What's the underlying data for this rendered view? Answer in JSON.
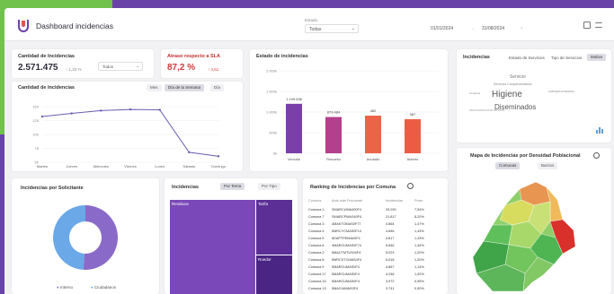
{
  "header": {
    "title": "Dashboard incidencias",
    "filter_label": "Estado",
    "filter_value": "Todas",
    "date_from": "01/01/2024",
    "date_to": "31/08/2024"
  },
  "kpi_incidencias": {
    "title": "Cantidad de Incidencias",
    "value": "2.571.475",
    "delta": "↑ 1,33 %",
    "select": "Todos"
  },
  "kpi_sla": {
    "title": "Atraso respecto a SLA",
    "value": "87,2 %",
    "delta": "↑ 4,61"
  },
  "line_card": {
    "title": "Cantidad de Incidencias",
    "tabs": [
      "Mes",
      "Día de la Semana",
      "Día"
    ],
    "chart_data": {
      "type": "line",
      "categories": [
        "Martes",
        "Jueves",
        "Miércoles",
        "Viernes",
        "Lunes",
        "Sábado",
        "Domingo"
      ],
      "values": [
        126,
        134,
        141,
        144,
        143,
        36,
        26
      ],
      "yticks": [
        "150",
        "125",
        "100",
        "75",
        "50"
      ],
      "ylim": [
        20,
        160
      ]
    }
  },
  "bar_card": {
    "title": "Estado de incidencias",
    "chart_data": {
      "type": "bar",
      "categories": [
        "Vencido",
        "Resuelto",
        "Anulado",
        "Abierto"
      ],
      "values": [
        1199536,
        879484,
        482,
        387
      ],
      "labels": [
        "1.199.536",
        "879.484",
        "482",
        "387"
      ],
      "colors": [
        "#7b3fa8",
        "#b43f8c",
        "#ec6448",
        "#ee5b45"
      ],
      "yticks": [
        "2.000k",
        "1.500k",
        "1.000k",
        "500k",
        "0k"
      ]
    }
  },
  "words_card": {
    "title": "Incidencias",
    "tabs": [
      "Estado de Servicios",
      "Tipo de Servicios",
      "Motivo"
    ],
    "words": [
      {
        "text": "Higiene",
        "size": 10
      },
      {
        "text": "Diseminados",
        "size": 8
      },
      {
        "text": "Servicio",
        "size": 5
      },
      {
        "text": "Servicios Complementarios",
        "size": 3.5
      },
      {
        "text": "LIMPIEZA INTEGRAL",
        "size": 3
      },
      {
        "text": "Limpieza",
        "size": 3
      },
      {
        "text": "PROPUESTAS POR VECINOS",
        "size": 2.8
      }
    ]
  },
  "donut_card": {
    "title": "Incidencias por Solicitante",
    "chart_data": {
      "type": "pie",
      "categories": [
        "Interno",
        "Ciudadanos"
      ],
      "values": [
        51,
        49
      ],
      "colors": [
        "#8a6ac8",
        "#6aa8e8"
      ]
    },
    "legend": [
      "Interno",
      "Ciudadanos"
    ]
  },
  "tree_card": {
    "title": "Incidencias",
    "tabs": [
      "Por Tema",
      "Por Tipo"
    ],
    "cells": [
      "Residuos",
      "Tarifa",
      "Roedor"
    ]
  },
  "ranking_card": {
    "title": "Ranking de Incidencias por Comuna",
    "headers": [
      "Comuna",
      "Auto más Frecuente",
      "Incidencias",
      "Prom"
    ],
    "rows": [
      [
        "Comuna 1",
        "SMARCUMA400F4",
        "33.290",
        "7,54%"
      ],
      [
        "Comuna 7",
        "SMARCPMAS40F4",
        "21.817",
        "5,20%"
      ],
      [
        "Comuna 3",
        "4MAKTOMAS0F77",
        "4.864",
        "1,47%"
      ],
      [
        "Comuna 4",
        "5MRCYCMAS0F14",
        "4.846",
        "1,43%"
      ],
      [
        "Comuna 5",
        "6DAPTPEMA00F4",
        "4.817",
        "1,43%"
      ],
      [
        "Comuna 6",
        "4MARCUMAS0F74",
        "5.846",
        "1,34%"
      ],
      [
        "Comuna 2",
        "5MACTMTUS00F4",
        "5.023",
        "1,20%"
      ],
      [
        "Comuna 8",
        "5MRCXTCMAS0F4",
        "5.018",
        "1,20%"
      ],
      [
        "Comuna 9",
        "5MARCUMAS0F4",
        "4.867",
        "1,14%"
      ],
      [
        "Comuna 17",
        "5MARCUMAS0F4",
        "4.246",
        "1,02%"
      ],
      [
        "Comuna 15",
        "5MARCUMAS0F4",
        "3.972",
        "0,95%"
      ],
      [
        "Comuna 13",
        "5MACIUMAS0F4",
        "3.741",
        "0,90%"
      ]
    ]
  },
  "map_card": {
    "title": "Mapa de Incidencias por Densidad Poblacional",
    "tabs": [
      "Comunas",
      "Barrios"
    ]
  }
}
